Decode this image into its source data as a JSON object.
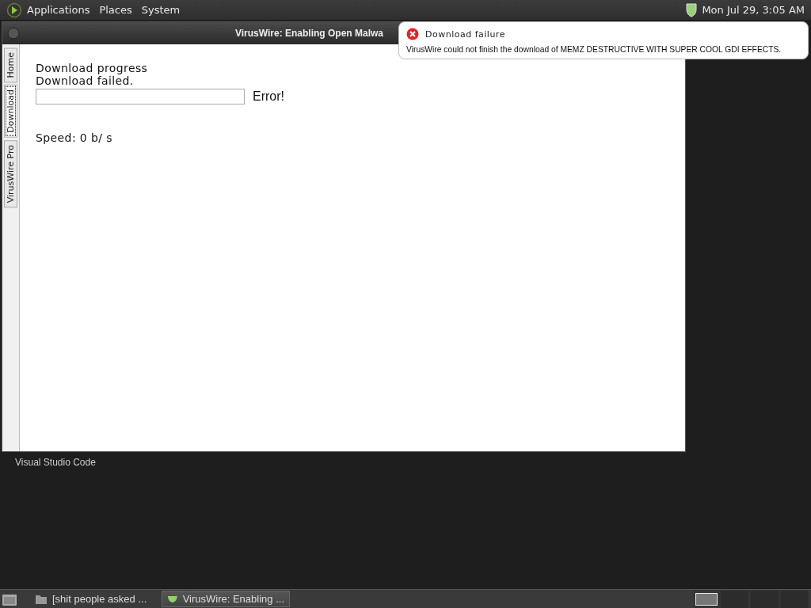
{
  "top_panel": {
    "menus": [
      "Applications",
      "Places",
      "System"
    ],
    "clock": "Mon Jul 29,  3:05 AM"
  },
  "window": {
    "title": "VirusWire: Enabling Open Malwa",
    "tabs": [
      {
        "label": "Home",
        "selected": false
      },
      {
        "label": "Download",
        "selected": true
      },
      {
        "label": "VirusWire Pro",
        "selected": false
      }
    ],
    "heading": "Download progress",
    "status": "Download failed.",
    "progress": {
      "level": 0
    },
    "error": "Error!",
    "speed": "Speed: 0 b/ s"
  },
  "notification": {
    "title": "Download failure",
    "body": "VirusWire could not finish the download of MEMZ DESTRUCTIVE WITH SUPER COOL GDI EFFECTS."
  },
  "desktop_icons": [
    {
      "label": "Visual Studio Code"
    }
  ],
  "taskbar": {
    "items": [
      {
        "label": "[shit people asked ...",
        "selected": false
      },
      {
        "label": "VirusWire: Enabling ...",
        "selected": true
      }
    ]
  }
}
